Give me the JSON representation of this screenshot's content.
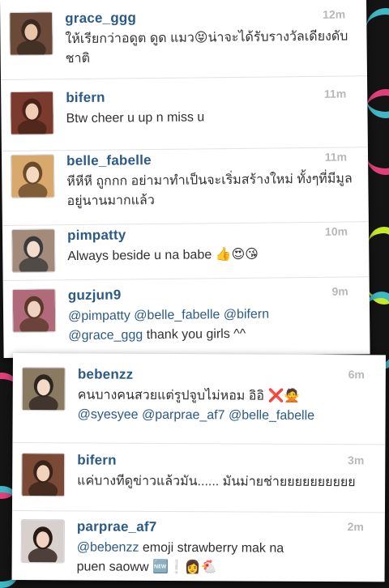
{
  "comments_top": [
    {
      "username": "grace_ggg",
      "time": "12m",
      "text": "ให้เรียกว่าอดูต ดูด แมว😝น่าจะได้รับรางวัลเดียงดับ\nชาติ",
      "avatar": "avatar-photo-icon"
    },
    {
      "username": "bifern",
      "time": "11m",
      "text": "Btw cheer u up n miss u",
      "avatar": "avatar-photo-icon"
    },
    {
      "username": "belle_fabelle",
      "time": "11m",
      "text": "หีหีหี ถูกกก อย่ามาทำเป็นจะเริ่มสร้างใหม่ ทั้งๆที่มีมูล\nอยู่นานมากแล้ว",
      "avatar": "avatar-photo-icon"
    },
    {
      "username": "pimpatty",
      "time": "10m",
      "text": "Always beside u na babe 👍😍😘",
      "avatar": "avatar-photo-icon"
    },
    {
      "username": "guzjun9",
      "time": "9m",
      "text": "@pimpatty @belle_fabelle @bifern\n@grace_ggg thank you girls ^^",
      "avatar": "avatar-photo-icon"
    }
  ],
  "comments_bottom": [
    {
      "username": "bebenzz",
      "time": "6m",
      "text": "คนบางคนสวยแต่รูปจูบไม่หอม อิอิ ❌🙅\n@syesyee @parprae_af7 @belle_fabelle",
      "avatar": "avatar-photo-icon"
    },
    {
      "username": "bifern",
      "time": "3m",
      "text": "แค่บางทีดูข่าวแล้วมัน...... มันม่ายช่ายยยยยยยยยย",
      "avatar": "avatar-photo-icon"
    },
    {
      "username": "parprae_af7",
      "time": "2m",
      "text": "@bebenzz emoji strawberry mak na\npuen saoww 🆕❕👩🐔",
      "avatar": "avatar-photo-icon"
    }
  ],
  "colors": {
    "username": "#2b5a86",
    "timestamp": "#b8b8b8",
    "text": "#303030",
    "background": "#141414",
    "accent_teal": "#3fb7c4",
    "accent_pink": "#e0407a",
    "accent_lime": "#c8e82c"
  }
}
